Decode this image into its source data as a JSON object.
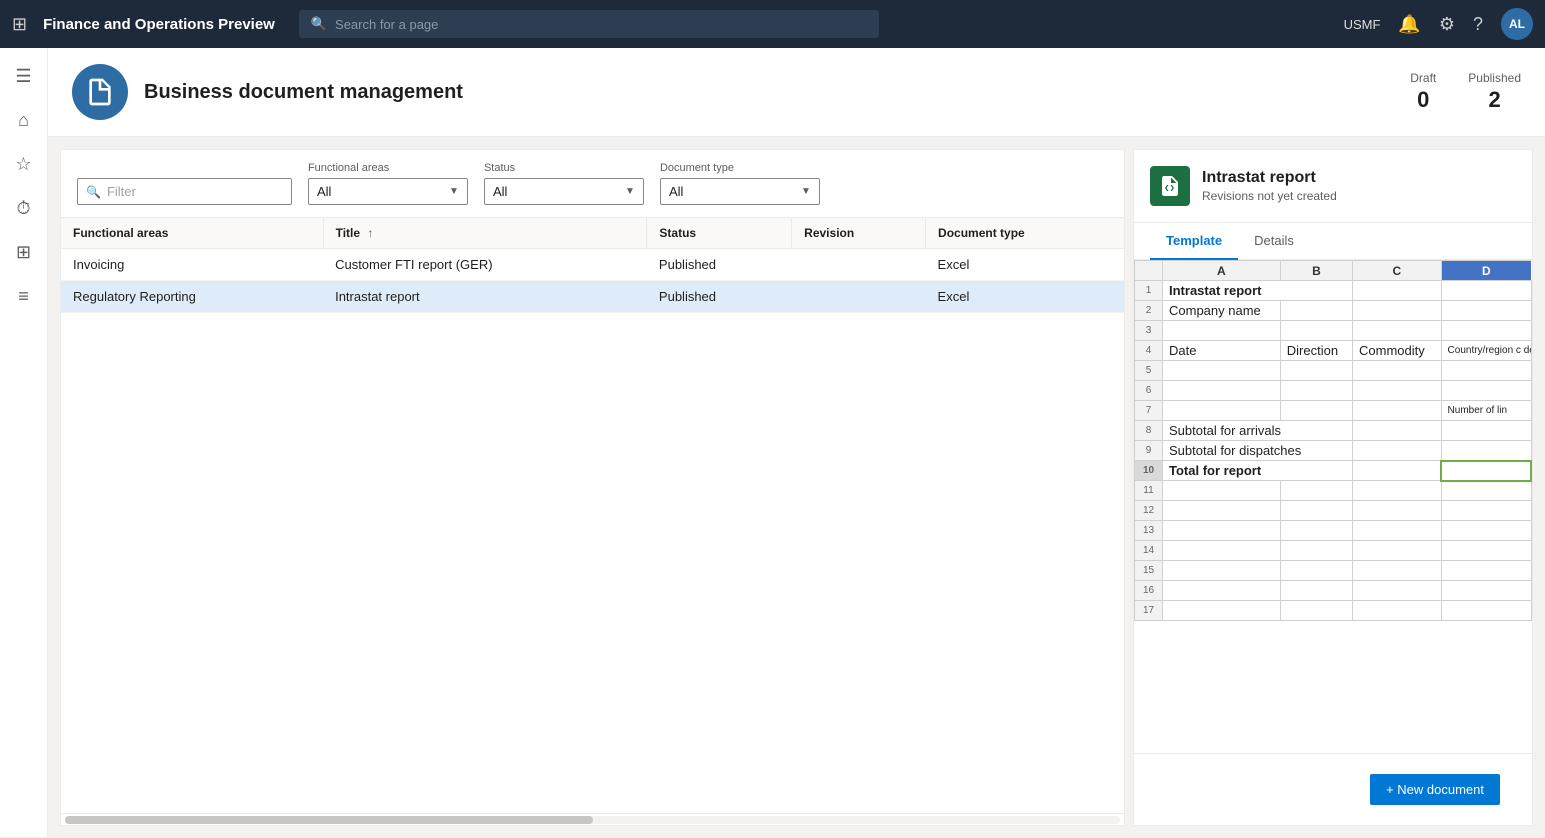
{
  "app": {
    "title": "Finance and Operations Preview",
    "search_placeholder": "Search for a page",
    "user_company": "USMF",
    "user_initials": "AL"
  },
  "sidebar": {
    "icons": [
      "≡",
      "⌂",
      "☆",
      "⏱",
      "⊞",
      "≡"
    ]
  },
  "page": {
    "title": "Business document management",
    "stats": {
      "draft_label": "Draft",
      "draft_value": "0",
      "published_label": "Published",
      "published_value": "2"
    }
  },
  "filters": {
    "filter_placeholder": "Filter",
    "functional_areas_label": "Functional areas",
    "functional_areas_value": "All",
    "status_label": "Status",
    "status_value": "All",
    "document_type_label": "Document type",
    "document_type_value": "All"
  },
  "table": {
    "columns": [
      {
        "key": "functional_areas",
        "label": "Functional areas",
        "sortable": false
      },
      {
        "key": "title",
        "label": "Title",
        "sortable": true
      },
      {
        "key": "status",
        "label": "Status",
        "sortable": false
      },
      {
        "key": "revision",
        "label": "Revision",
        "sortable": false
      },
      {
        "key": "document_type",
        "label": "Document type",
        "sortable": false
      }
    ],
    "rows": [
      {
        "functional_areas": "Invoicing",
        "title": "Customer FTI report (GER)",
        "status": "Published",
        "revision": "",
        "document_type": "Excel"
      },
      {
        "functional_areas": "Regulatory Reporting",
        "title": "Intrastat report",
        "status": "Published",
        "revision": "",
        "document_type": "Excel"
      }
    ]
  },
  "right_panel": {
    "title": "Intrastat report",
    "subtitle": "Revisions not yet created",
    "tabs": [
      "Template",
      "Details"
    ],
    "active_tab": "Template",
    "new_doc_button": "+ New document",
    "excel": {
      "col_headers": [
        "",
        "A",
        "B",
        "C",
        "D"
      ],
      "rows": [
        {
          "num": "1",
          "cells": [
            "Intrastat report",
            "",
            "",
            ""
          ]
        },
        {
          "num": "2",
          "cells": [
            "Company name",
            "",
            "",
            ""
          ]
        },
        {
          "num": "3",
          "cells": [
            "",
            "",
            "",
            ""
          ]
        },
        {
          "num": "4",
          "cells": [
            "Date",
            "Direction",
            "Commodity",
            "Country/region c destination"
          ]
        },
        {
          "num": "5",
          "cells": [
            "",
            "",
            "",
            ""
          ]
        },
        {
          "num": "6",
          "cells": [
            "",
            "",
            "",
            ""
          ]
        },
        {
          "num": "7",
          "cells": [
            "",
            "",
            "",
            "Number of lin"
          ]
        },
        {
          "num": "8",
          "cells": [
            "Subtotal for arrivals",
            "",
            "",
            ""
          ]
        },
        {
          "num": "9",
          "cells": [
            "Subtotal for dispatches",
            "",
            "",
            ""
          ]
        },
        {
          "num": "10",
          "cells": [
            "Total for report",
            "",
            "",
            ""
          ]
        },
        {
          "num": "11",
          "cells": [
            "",
            "",
            "",
            ""
          ]
        },
        {
          "num": "12",
          "cells": [
            "",
            "",
            "",
            ""
          ]
        },
        {
          "num": "13",
          "cells": [
            "",
            "",
            "",
            ""
          ]
        },
        {
          "num": "14",
          "cells": [
            "",
            "",
            "",
            ""
          ]
        },
        {
          "num": "15",
          "cells": [
            "",
            "",
            "",
            ""
          ]
        },
        {
          "num": "16",
          "cells": [
            "",
            "",
            "",
            ""
          ]
        },
        {
          "num": "17",
          "cells": [
            "",
            "",
            "",
            ""
          ]
        }
      ]
    }
  }
}
